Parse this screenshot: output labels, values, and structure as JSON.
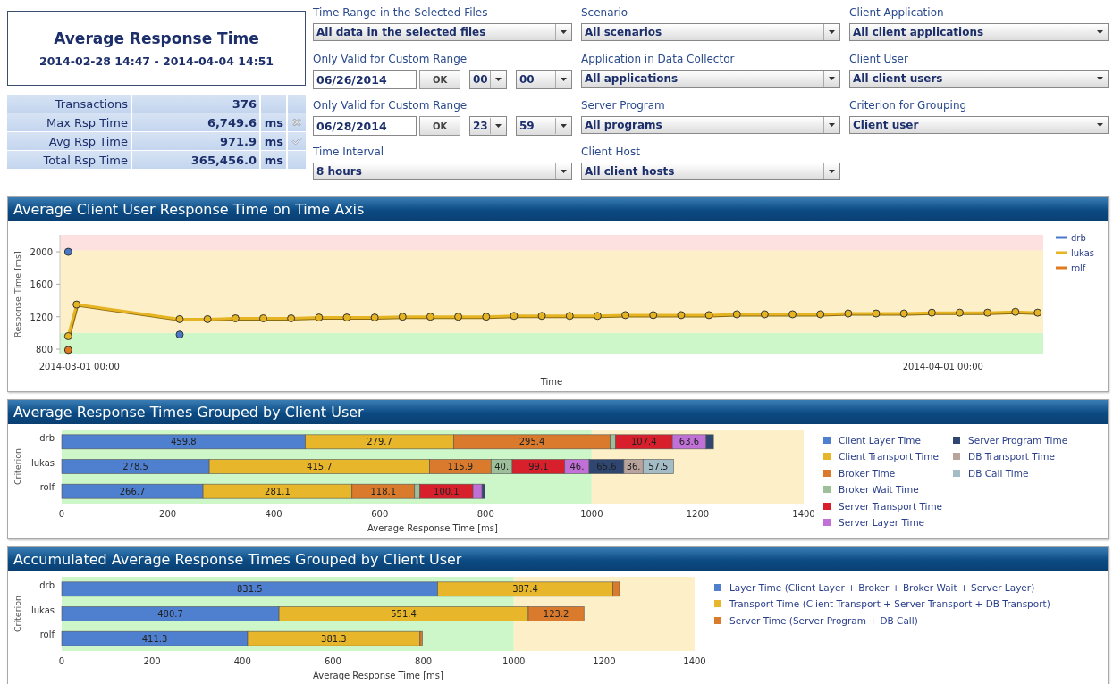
{
  "summary": {
    "title": "Average Response Time",
    "period": "2014-02-28 14:47 - 2014-04-04 14:51",
    "stats": [
      {
        "label": "Transactions",
        "value": "376",
        "alert": false,
        "passed": false
      },
      {
        "label": "Max Rsp Time",
        "value": "6,749.6",
        "unit": "ms",
        "alert": true,
        "passed": false
      },
      {
        "label": "Avg Rsp Time",
        "value": "971.9",
        "unit": "ms",
        "alert": false,
        "passed": true
      },
      {
        "label": "Total Rsp Time",
        "value": "365,456.0",
        "unit": "ms",
        "alert": false,
        "passed": false
      }
    ]
  },
  "filters": [
    [
      {
        "kind": "select",
        "label": "Time Range in the Selected Files",
        "value": "All data in the selected files"
      },
      {
        "kind": "date",
        "label": "Only Valid for Custom Range",
        "value": "06/26/2014",
        "button": "OK",
        "hour": "00",
        "minute": "00"
      },
      {
        "kind": "date",
        "label": "Only Valid for Custom Range",
        "value": "06/28/2014",
        "button": "OK",
        "hour": "23",
        "minute": "59"
      },
      {
        "kind": "select",
        "label": "Time Interval",
        "value": "8 hours"
      }
    ],
    [
      {
        "kind": "select",
        "label": "Scenario",
        "value": "All scenarios"
      },
      {
        "kind": "select",
        "label": "Application in Data Collector",
        "value": "All applications"
      },
      {
        "kind": "select",
        "label": "Server Program",
        "value": "All programs"
      },
      {
        "kind": "select",
        "label": "Client Host",
        "value": "All client hosts"
      }
    ],
    [
      {
        "kind": "select",
        "label": "Client Application",
        "value": "All client applications"
      },
      {
        "kind": "select",
        "label": "Client User",
        "value": "All client users"
      },
      {
        "kind": "select",
        "label": "Criterion for Grouping",
        "value": "Client user"
      }
    ]
  ],
  "panels": [
    {
      "title": "Average Client User Response Time on Time Axis",
      "chart_data": {
        "type": "line",
        "xlabel": "Time",
        "ylabel": "Response Time [ms]",
        "xlim": [
          "2014-02-28 07:12",
          "2014-04-04 14:24"
        ],
        "ylim": [
          745,
          2210
        ],
        "yticks": [
          800,
          1200,
          1600,
          2000
        ],
        "xticks": [
          "2014-03-01 00:00",
          "2014-04-01 00:00"
        ],
        "legend": true,
        "x": [
          "2014-02-28 14:24",
          "2014-02-28 21:36",
          "2014-03-04 14:24",
          "2014-03-05 14:24",
          "2014-03-06 14:24",
          "2014-03-07 14:24",
          "2014-03-08 14:24",
          "2014-03-09 14:24",
          "2014-03-10 14:24",
          "2014-03-11 14:24",
          "2014-03-12 14:24",
          "2014-03-13 14:24",
          "2014-03-14 14:24",
          "2014-03-15 14:24",
          "2014-03-16 14:24",
          "2014-03-17 14:24",
          "2014-03-18 14:24",
          "2014-03-19 14:24",
          "2014-03-20 14:24",
          "2014-03-21 14:24",
          "2014-03-22 14:24",
          "2014-03-23 14:24",
          "2014-03-24 14:24",
          "2014-03-25 14:24",
          "2014-03-26 14:24",
          "2014-03-27 14:24",
          "2014-03-28 14:24",
          "2014-03-29 14:24",
          "2014-03-30 14:24",
          "2014-03-31 14:24",
          "2014-04-01 14:24",
          "2014-04-02 14:24",
          "2014-04-03 14:24",
          "2014-04-04 09:36"
        ],
        "series": [
          {
            "name": "drb",
            "type": "scatter",
            "marker": "circle",
            "color": "#4a78c8",
            "values": [
              2000,
              null,
              980,
              null,
              null,
              null,
              null,
              null,
              null,
              null,
              null,
              null,
              null,
              null,
              null,
              null,
              null,
              null,
              null,
              null,
              null,
              null,
              null,
              null,
              null,
              null,
              null,
              null,
              null,
              null,
              null,
              null,
              null,
              null
            ]
          },
          {
            "name": "lukas",
            "type": "line",
            "marker": "circle",
            "color": "#e6b422",
            "values": [
              960,
              1350,
              1170,
              1170,
              1180,
              1180,
              1180,
              1190,
              1190,
              1190,
              1200,
              1200,
              1200,
              1200,
              1210,
              1210,
              1210,
              1210,
              1220,
              1220,
              1220,
              1220,
              1230,
              1230,
              1230,
              1230,
              1240,
              1240,
              1240,
              1250,
              1250,
              1250,
              1260,
              1250
            ]
          },
          {
            "name": "rolf",
            "type": "scatter",
            "marker": "circle",
            "color": "#e07a1f",
            "values": [
              790,
              null,
              null,
              null,
              null,
              null,
              null,
              null,
              null,
              null,
              null,
              null,
              null,
              null,
              null,
              null,
              null,
              null,
              null,
              null,
              null,
              null,
              null,
              null,
              null,
              null,
              null,
              null,
              null,
              null,
              null,
              null,
              null,
              null
            ]
          }
        ],
        "bands": [
          {
            "axis": "y",
            "from": 745,
            "to": 1000,
            "color": "#cdf7c8"
          },
          {
            "axis": "y",
            "from": 1000,
            "to": 2020,
            "color": "#fdf0c9"
          },
          {
            "axis": "y",
            "from": 2020,
            "to": 2210,
            "color": "#fde0e0"
          }
        ]
      }
    },
    {
      "title": "Average Response Times Grouped by Client User",
      "chart_data": {
        "type": "bar",
        "orientation": "horizontal",
        "stacked": true,
        "xlabel": "Average Response Time [ms]",
        "ylabel": "Criterion",
        "categories": [
          "drb",
          "lukas",
          "rolf"
        ],
        "xlim": [
          0,
          1400
        ],
        "xticks": [
          0,
          200,
          400,
          600,
          800,
          1000,
          1200,
          1400
        ],
        "series": [
          {
            "name": "Client Layer Time",
            "color": "#4f7fcf",
            "values": [
              459.8,
              278.5,
              266.7
            ]
          },
          {
            "name": "Client Transport Time",
            "color": "#e8b62a",
            "values": [
              279.7,
              415.7,
              281.1
            ]
          },
          {
            "name": "Broker Time",
            "color": "#d97a2c",
            "values": [
              295.4,
              115.9,
              118.1
            ]
          },
          {
            "name": "Broker Wait Time",
            "color": "#9dbf9a",
            "values": [
              10,
              40,
              10
            ]
          },
          {
            "name": "Server Transport Time",
            "color": "#d8202c",
            "values": [
              107.4,
              99.1,
              100.1
            ]
          },
          {
            "name": "Server Layer Time",
            "color": "#c070d6",
            "values": [
              63.6,
              46,
              17
            ]
          },
          {
            "name": "Server Program Time",
            "color": "#2e4670",
            "values": [
              14,
              65.6,
              5
            ]
          },
          {
            "name": "DB Transport Time",
            "color": "#b8a49c",
            "values": [
              null,
              36,
              null
            ]
          },
          {
            "name": "DB Call Time",
            "color": "#a3bcc6",
            "values": [
              null,
              57.5,
              null
            ]
          }
        ],
        "value_labels": [
          [
            "459.8",
            "278.5",
            "266.7"
          ],
          [
            "279.7",
            "415.7",
            "281.1"
          ],
          [
            "295.4",
            "115.9",
            "118.1"
          ],
          [
            null,
            "40.",
            null
          ],
          [
            "107.4",
            "99.1",
            "100.1"
          ],
          [
            "63.6",
            "46.",
            null
          ],
          [
            null,
            "65.6",
            null
          ],
          [
            null,
            "36.",
            null
          ],
          [
            null,
            "57.5",
            null
          ]
        ],
        "bands": [
          {
            "axis": "x",
            "from": 0,
            "to": 1000,
            "color": "#cdf7c8"
          },
          {
            "axis": "x",
            "from": 1000,
            "to": 1400,
            "color": "#fdf0c9"
          }
        ]
      }
    },
    {
      "title": "Accumulated Average Response Times Grouped by Client User",
      "chart_data": {
        "type": "bar",
        "orientation": "horizontal",
        "stacked": true,
        "xlabel": "Average Response Time [ms]",
        "ylabel": "Criterion",
        "categories": [
          "drb",
          "lukas",
          "rolf"
        ],
        "xlim": [
          0,
          1400
        ],
        "xticks": [
          0,
          200,
          400,
          600,
          800,
          1000,
          1200,
          1400
        ],
        "series": [
          {
            "name": "Layer Time  (Client Layer + Broker + Broker Wait + Server Layer)",
            "color": "#4f7fcf",
            "values": [
              831.5,
              480.7,
              411.3
            ]
          },
          {
            "name": "Transport Time  (Client Transport + Server Transport + DB Transport)",
            "color": "#e8b62a",
            "values": [
              387.4,
              551.4,
              381.3
            ]
          },
          {
            "name": "Server Time  (Server Program + DB Call)",
            "color": "#d97a2c",
            "values": [
              15,
              123.2,
              5
            ]
          }
        ],
        "value_labels": [
          [
            "831.5",
            "480.7",
            "411.3"
          ],
          [
            "387.4",
            "551.4",
            "381.3"
          ],
          [
            null,
            "123.2",
            null
          ]
        ],
        "bands": [
          {
            "axis": "x",
            "from": 0,
            "to": 1000,
            "color": "#cdf7c8"
          },
          {
            "axis": "x",
            "from": 1000,
            "to": 1400,
            "color": "#fdf0c9"
          }
        ]
      }
    }
  ]
}
